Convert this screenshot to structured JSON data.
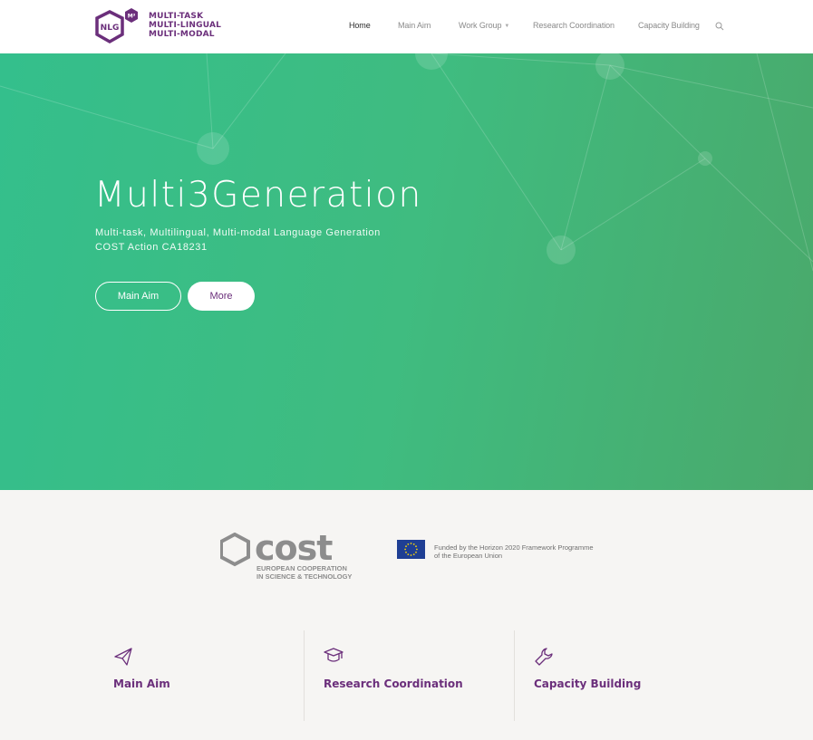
{
  "header": {
    "logo": {
      "badge": "NLG",
      "superscript": "M³",
      "lines": [
        "MULTI-TASK",
        "MULTI-LINGUAL",
        "MULTI-MODAL"
      ]
    },
    "nav": [
      {
        "label": "Home",
        "active": true
      },
      {
        "label": "Main Aim"
      },
      {
        "label": "Work Group",
        "has_dropdown": true
      },
      {
        "label": "Research Coordination"
      },
      {
        "label": "Capacity Building"
      }
    ],
    "search_icon": "search-icon"
  },
  "hero": {
    "title": "Multi3Generation",
    "subtitle_line1": "Multi-task, Multilingual, Multi-modal Language Generation",
    "subtitle_line2": "COST Action CA18231",
    "buttons": [
      {
        "label": "Main Aim"
      },
      {
        "label": "More"
      }
    ]
  },
  "sponsors": {
    "cost": {
      "wordmark": "cost",
      "line1": "EUROPEAN COOPERATION",
      "line2": "IN SCIENCE & TECHNOLOGY"
    },
    "eu": {
      "line1": "Funded by the Horizon 2020 Framework Programme",
      "line2": "of the European Union"
    }
  },
  "features": [
    {
      "title": "Main Aim",
      "icon": "paper-plane-icon"
    },
    {
      "title": "Research Coordination",
      "icon": "graduation-cap-icon"
    },
    {
      "title": "Capacity Building",
      "icon": "wrench-icon"
    }
  ],
  "colors": {
    "brand_purple": "#6b2f7b",
    "hero_green": "#3fbc80",
    "eu_blue": "#1f3f94",
    "eu_star": "#f5d20a"
  }
}
